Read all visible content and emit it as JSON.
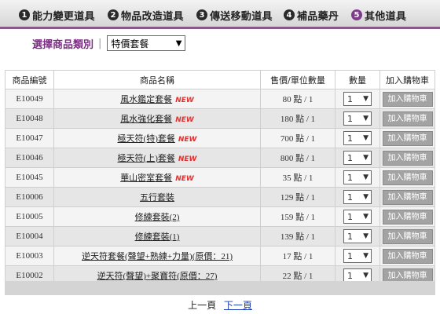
{
  "tabs": [
    {
      "num": "1",
      "label": "能力變更道具"
    },
    {
      "num": "2",
      "label": "物品改造道具"
    },
    {
      "num": "3",
      "label": "傳送移動道具"
    },
    {
      "num": "4",
      "label": "補品藥丹"
    },
    {
      "num": "5",
      "label": "其他道具",
      "active": true
    }
  ],
  "filter": {
    "label": "選擇商品類別",
    "separator": "|",
    "selected": "特價套餐"
  },
  "table": {
    "headers": [
      "商品編號",
      "商品名稱",
      "售價/單位數量",
      "數量",
      "加入購物車"
    ],
    "rows": [
      {
        "id": "E10049",
        "name": "風水鑑定套餐",
        "new": true,
        "price": "80 點 / 1",
        "qty": "1",
        "button": "加入購物車"
      },
      {
        "id": "E10048",
        "name": "風水強化套餐",
        "new": true,
        "price": "180 點 / 1",
        "qty": "1",
        "button": "加入購物車"
      },
      {
        "id": "E10047",
        "name": "極天符(特)套餐",
        "new": true,
        "price": "700 點 / 1",
        "qty": "1",
        "button": "加入購物車"
      },
      {
        "id": "E10046",
        "name": "極天符(上)套餐",
        "new": true,
        "price": "800 點 / 1",
        "qty": "1",
        "button": "加入購物車"
      },
      {
        "id": "E10045",
        "name": "華山密室套餐",
        "new": true,
        "price": "35 點 / 1",
        "qty": "1",
        "button": "加入購物車"
      },
      {
        "id": "E10006",
        "name": "五行套裝",
        "new": false,
        "price": "129 點 / 1",
        "qty": "1",
        "button": "加入購物車"
      },
      {
        "id": "E10005",
        "name": "修練套裝(2)",
        "new": false,
        "price": "159 點 / 1",
        "qty": "1",
        "button": "加入購物車"
      },
      {
        "id": "E10004",
        "name": "修練套裝(1)",
        "new": false,
        "price": "139 點 / 1",
        "qty": "1",
        "button": "加入購物車"
      },
      {
        "id": "E10003",
        "name": "逆天符套餐(聲望+熟練+力量)(原價：21)",
        "new": false,
        "price": "17 點 / 1",
        "qty": "1",
        "button": "加入購物車"
      },
      {
        "id": "E10002",
        "name": "逆天符(聲望)+聚寶符(原價：27)",
        "new": false,
        "price": "22 點 / 1",
        "qty": "1",
        "button": "加入購物車"
      }
    ],
    "new_badge": "NEW"
  },
  "pager": {
    "prev": "上一頁",
    "next": "下一頁"
  },
  "colors": {
    "accent": "#7b2f82",
    "tab_border": "#8a5a86",
    "new_badge": "#dd3333",
    "row_odd": "#f4f4f4",
    "row_even": "#e6e6e6",
    "button_bg": "#a3a3a3"
  }
}
